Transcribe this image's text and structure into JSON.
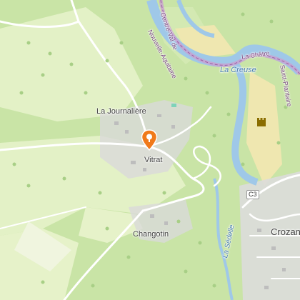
{
  "map": {
    "places": {
      "la_journaliere": "La Journalière",
      "vitrat": "Vitrat",
      "changotin": "Changotin",
      "crozant": "Crozan"
    },
    "boundary": {
      "label_a": "Centre-Val de",
      "label_b": "Nouvelle-Aquitaine",
      "label_c": "La Châtre"
    },
    "water": {
      "creuse": "La Creuse",
      "sedelle": "La Sédelle",
      "saint_plantaire": "Saint-Plantaire"
    },
    "roads": {
      "c3": "C3"
    },
    "marker": {
      "icon": "location-pin-icon",
      "color": "#f07a1a"
    },
    "colors": {
      "forest": "#c9e4a6",
      "field": "#e6f2c9",
      "water": "#9fc8e8",
      "road": "#ffffff",
      "boundary": "#b07ab6",
      "urban": "#dadada"
    }
  }
}
